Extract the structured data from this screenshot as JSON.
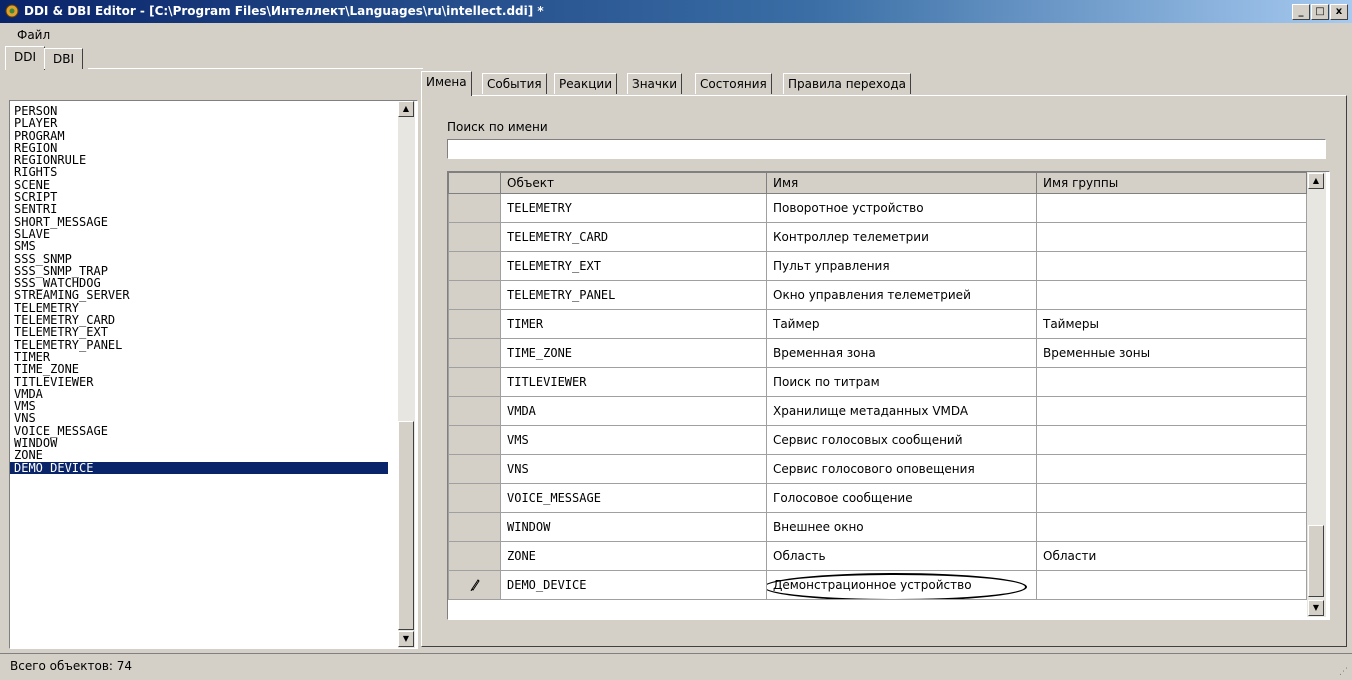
{
  "window": {
    "title": "DDI & DBI Editor - [C:\\Program Files\\Интеллект\\Languages\\ru\\intellect.ddi] *",
    "minimize": "_",
    "maximize": "□",
    "close": "x"
  },
  "menu": {
    "file": "Файл"
  },
  "left_tabs": [
    "DDI",
    "DBI"
  ],
  "left_list": {
    "items": [
      "PERSON",
      "PLAYER",
      "PROGRAM",
      "REGION",
      "REGIONRULE",
      "RIGHTS",
      "SCENE",
      "SCRIPT",
      "SENTRI",
      "SHORT_MESSAGE",
      "SLAVE",
      "SMS",
      "SSS_SNMP",
      "SSS_SNMP_TRAP",
      "SSS_WATCHDOG",
      "STREAMING_SERVER",
      "TELEMETRY",
      "TELEMETRY_CARD",
      "TELEMETRY_EXT",
      "TELEMETRY_PANEL",
      "TIMER",
      "TIME_ZONE",
      "TITLEVIEWER",
      "VMDA",
      "VMS",
      "VNS",
      "VOICE_MESSAGE",
      "WINDOW",
      "ZONE",
      "DEMO_DEVICE"
    ],
    "selected": "DEMO_DEVICE"
  },
  "right_tabs": [
    "Имена",
    "События",
    "Реакции",
    "Значки",
    "Состояния",
    "Правила перехода"
  ],
  "active_tab": "Имена",
  "search": {
    "label": "Поиск по имени",
    "value": ""
  },
  "grid": {
    "columns": [
      "Объект",
      "Имя",
      "Имя группы"
    ],
    "rows": [
      {
        "object": "TELEMETRY",
        "name": "Поворотное устройство",
        "group": ""
      },
      {
        "object": "TELEMETRY_CARD",
        "name": "Контроллер телеметрии",
        "group": ""
      },
      {
        "object": "TELEMETRY_EXT",
        "name": "Пульт управления",
        "group": ""
      },
      {
        "object": "TELEMETRY_PANEL",
        "name": "Окно управления телеметрией",
        "group": ""
      },
      {
        "object": "TIMER",
        "name": "Таймер",
        "group": "Таймеры"
      },
      {
        "object": "TIME_ZONE",
        "name": "Временная зона",
        "group": "Временные зоны"
      },
      {
        "object": "TITLEVIEWER",
        "name": "Поиск по титрам",
        "group": ""
      },
      {
        "object": "VMDA",
        "name": "Хранилище метаданных VMDA",
        "group": ""
      },
      {
        "object": "VMS",
        "name": "Сервис голосовых сообщений",
        "group": ""
      },
      {
        "object": "VNS",
        "name": "Сервис голосового оповещения",
        "group": ""
      },
      {
        "object": "VOICE_MESSAGE",
        "name": "Голосовое сообщение",
        "group": ""
      },
      {
        "object": "WINDOW",
        "name": "Внешнее окно",
        "group": ""
      },
      {
        "object": "ZONE",
        "name": "Область",
        "group": "Области"
      },
      {
        "object": "DEMO_DEVICE",
        "name": "Демонстрационное устройство",
        "group": "",
        "editing": true
      }
    ]
  },
  "status": {
    "text": "Всего объектов: 74"
  },
  "icons": {
    "app": "app-icon",
    "edit_row": "pencil-icon",
    "scroll_up": "arrow-up-icon",
    "scroll_down": "arrow-down-icon"
  },
  "colors": {
    "selection": "#0a246a",
    "face": "#d4d0c8",
    "titlebar": "#0a246a"
  }
}
